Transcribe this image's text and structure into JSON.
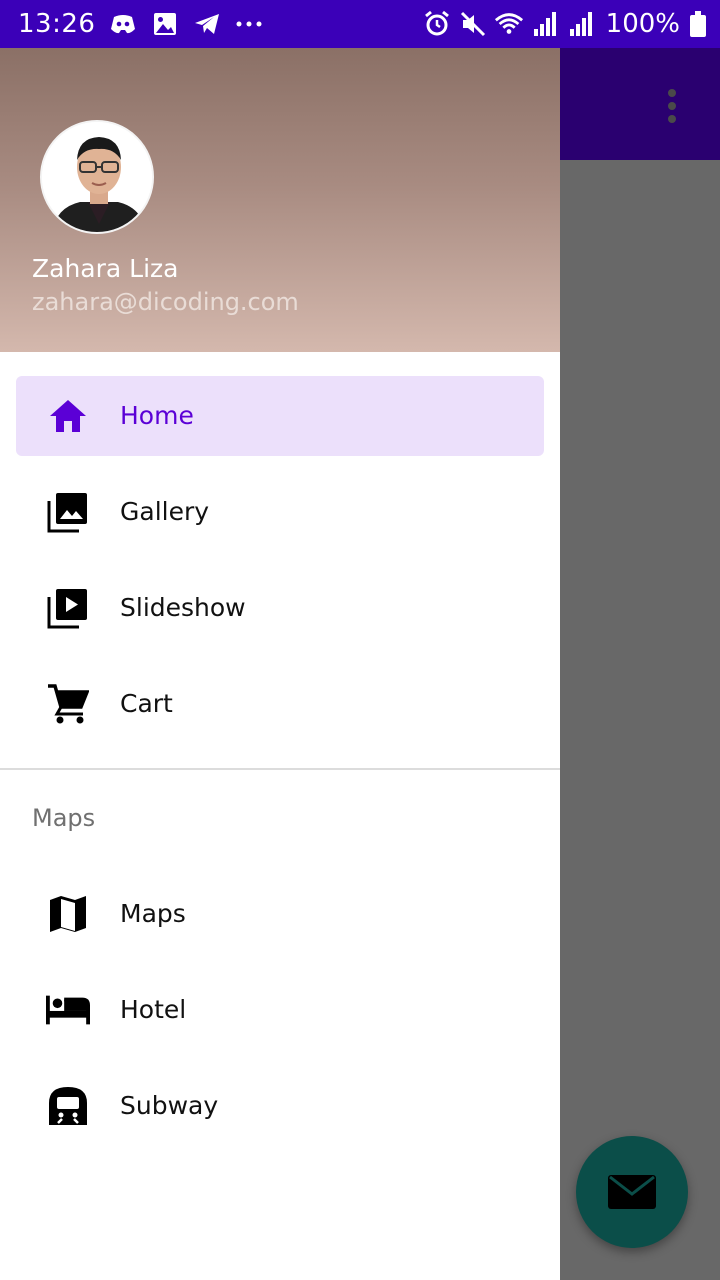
{
  "status_bar": {
    "time": "13:26",
    "battery": "100%",
    "left_icons": [
      "discord-icon",
      "image-icon",
      "telegram-icon",
      "more-icon"
    ],
    "right_icons": [
      "alarm-icon",
      "mute-icon",
      "wifi-icon",
      "signal-icon",
      "signal-icon"
    ]
  },
  "header": {
    "name": "Zahara Liza",
    "email": "zahara@dicoding.com"
  },
  "menu": {
    "items": [
      {
        "label": "Home",
        "icon": "home-icon",
        "active": true
      },
      {
        "label": "Gallery",
        "icon": "gallery-icon",
        "active": false
      },
      {
        "label": "Slideshow",
        "icon": "slideshow-icon",
        "active": false
      },
      {
        "label": "Cart",
        "icon": "cart-icon",
        "active": false
      }
    ],
    "section_title": "Maps",
    "section_items": [
      {
        "label": "Maps",
        "icon": "map-icon"
      },
      {
        "label": "Hotel",
        "icon": "hotel-icon"
      },
      {
        "label": "Subway",
        "icon": "subway-icon"
      }
    ]
  },
  "colors": {
    "status_bar": "#3b00b8",
    "app_bar": "#2a0070",
    "accent": "#5b00d6",
    "active_bg": "#ece0fb",
    "fab": "#0b4e49",
    "scrim": "#686868"
  },
  "fab": {
    "icon": "mail-icon"
  }
}
